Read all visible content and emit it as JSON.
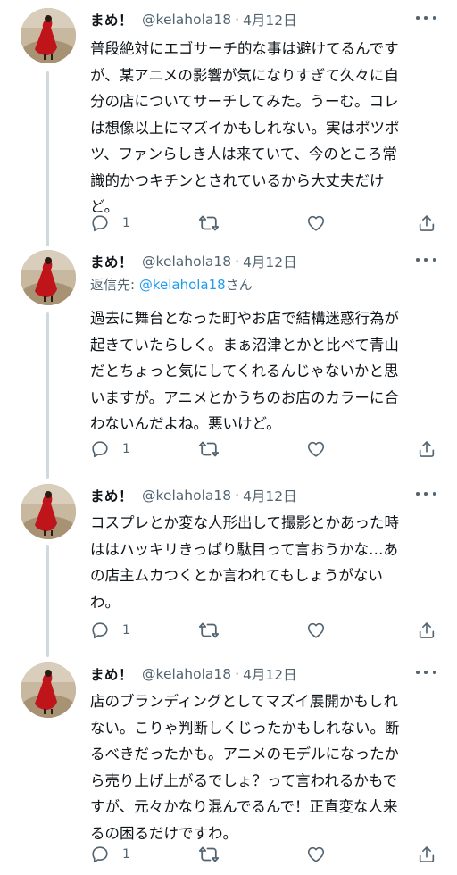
{
  "colors": {
    "text": "#0f1419",
    "secondary": "#536471",
    "mention": "#1d9bf0",
    "thread_line": "#cfd9de"
  },
  "icons": [
    "reply-icon",
    "retweet-icon",
    "like-icon",
    "share-icon",
    "more-icon"
  ],
  "tweets": [
    {
      "name": "まめ！",
      "handle": "@kelahola18",
      "separator": "·",
      "date": "4月12日",
      "body_lines": [
        "普段絶対にエゴサーチ的な事は避けてるんです",
        "が、某アニメの影響が気になりすぎて久々に自",
        "分の店についてサーチしてみた。うーむ。コレ",
        "は想像以上にマズイかもしれない。実はポツポ",
        "ツ、ファンらしき人は来ていて、今のところ常",
        "識的かつキチンとされているから大丈夫だけ",
        "ど。"
      ],
      "reply_count": "1"
    },
    {
      "name": "まめ！",
      "handle": "@kelahola18",
      "separator": "·",
      "date": "4月12日",
      "reply_prefix": "返信先: ",
      "reply_mention": "@kelahola18",
      "reply_suffix": "さん",
      "body_lines": [
        "過去に舞台となった町やお店で結構迷惑行為が",
        "起きていたらしく。まぁ沼津とかと比べて青山",
        "だとちょっと気にしてくれるんじゃないかと思",
        "いますが。アニメとかうちのお店のカラーに合",
        "わないんだよね。悪いけど。"
      ],
      "reply_count": "1"
    },
    {
      "name": "まめ！",
      "handle": "@kelahola18",
      "separator": "·",
      "date": "4月12日",
      "body_lines": [
        "コスプレとか変な人形出して撮影とかあった時",
        "ははハッキリきっぱり駄目って言おうかな…あ",
        "の店主ムカつくとか言われてもしょうがない",
        "わ。"
      ],
      "reply_count": "1"
    },
    {
      "name": "まめ！",
      "handle": "@kelahola18",
      "separator": "·",
      "date": "4月12日",
      "body_lines": [
        "店のブランディングとしてマズイ展開かもしれ",
        "ない。こりゃ判断しくじったかもしれない。断",
        "るべきだったかも。アニメのモデルになったか",
        "ら売り上げ上がるでしょ？って言われるかもで",
        "すが、元々かなり混んでるんで！正直変な人来",
        "るの困るだけですわ。"
      ],
      "reply_count": "1"
    }
  ]
}
